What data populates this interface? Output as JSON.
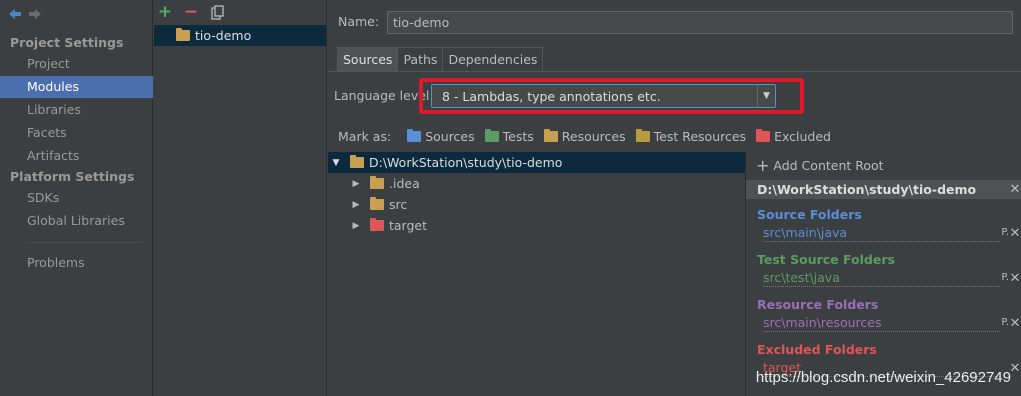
{
  "colors": {
    "nav_selected": "#4b6eaf",
    "tree_selected": "#0d293e",
    "source": "#5a8fd6",
    "test": "#5b9c62",
    "resource": "#9a6fb3",
    "excluded": "#e05555",
    "folder_plain": "#c8a04f",
    "annotation_red": "#e0192a"
  },
  "nav": {
    "project_settings": "Project Settings",
    "project_items": [
      "Project",
      "Modules",
      "Libraries",
      "Facets",
      "Artifacts"
    ],
    "platform_settings": "Platform Settings",
    "platform_items": [
      "SDKs",
      "Global Libraries"
    ],
    "problems": "Problems",
    "selected": "Modules"
  },
  "modules": {
    "items": [
      "tio-demo"
    ]
  },
  "main": {
    "name_label": "Name:",
    "name_value": "tio-demo",
    "tabs": [
      "Sources",
      "Paths",
      "Dependencies"
    ],
    "active_tab": "Sources",
    "language_label": "Language level:",
    "language_value": "8 - Lambdas, type annotations etc.",
    "mark_as": {
      "label": "Mark as:",
      "options": [
        "Sources",
        "Tests",
        "Resources",
        "Test Resources",
        "Excluded"
      ]
    },
    "tree": {
      "root": "D:\\WorkStation\\study\\tio-demo",
      "children": [
        ".idea",
        "src",
        "target"
      ]
    },
    "roots_panel": {
      "add_content_root": "Add Content Root",
      "header": "D:\\WorkStation\\study\\tio-demo",
      "groups": [
        {
          "title": "Source Folders",
          "path": "src\\main\\java"
        },
        {
          "title": "Test Source Folders",
          "path": "src\\test\\java"
        },
        {
          "title": "Resource Folders",
          "path": "src\\main\\resources"
        },
        {
          "title": "Excluded Folders",
          "path": "target"
        }
      ],
      "prop_button": "P."
    }
  },
  "watermark": "https://blog.csdn.net/weixin_42692749"
}
